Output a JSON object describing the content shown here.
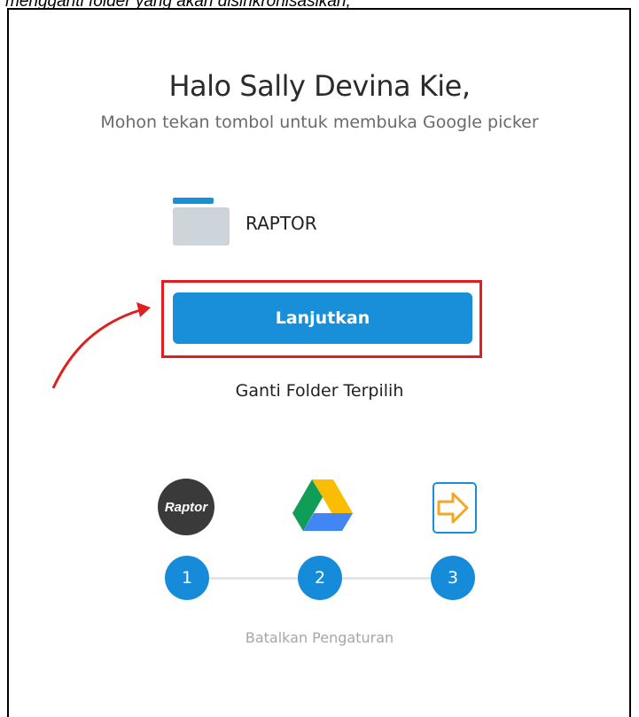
{
  "caption": "mengganti folder yang akan disinkronisasikan;",
  "greeting": "Halo Sally Devina Kie,",
  "instruction": "Mohon tekan tombol untuk membuka Google picker",
  "folder": {
    "name": "RAPTOR",
    "icon": "folder-icon"
  },
  "buttons": {
    "continue_label": "Lanjutkan",
    "change_folder_label": "Ganti Folder Terpilih",
    "cancel_label": "Batalkan Pengaturan"
  },
  "steps": [
    {
      "number": "1",
      "logo": "raptor-logo",
      "logo_text": "Raptor"
    },
    {
      "number": "2",
      "logo": "google-drive-logo"
    },
    {
      "number": "3",
      "logo": "import-icon"
    }
  ],
  "colors": {
    "accent": "#1a8fd9",
    "highlight": "#e02020",
    "import_icon": "#f5a623"
  }
}
